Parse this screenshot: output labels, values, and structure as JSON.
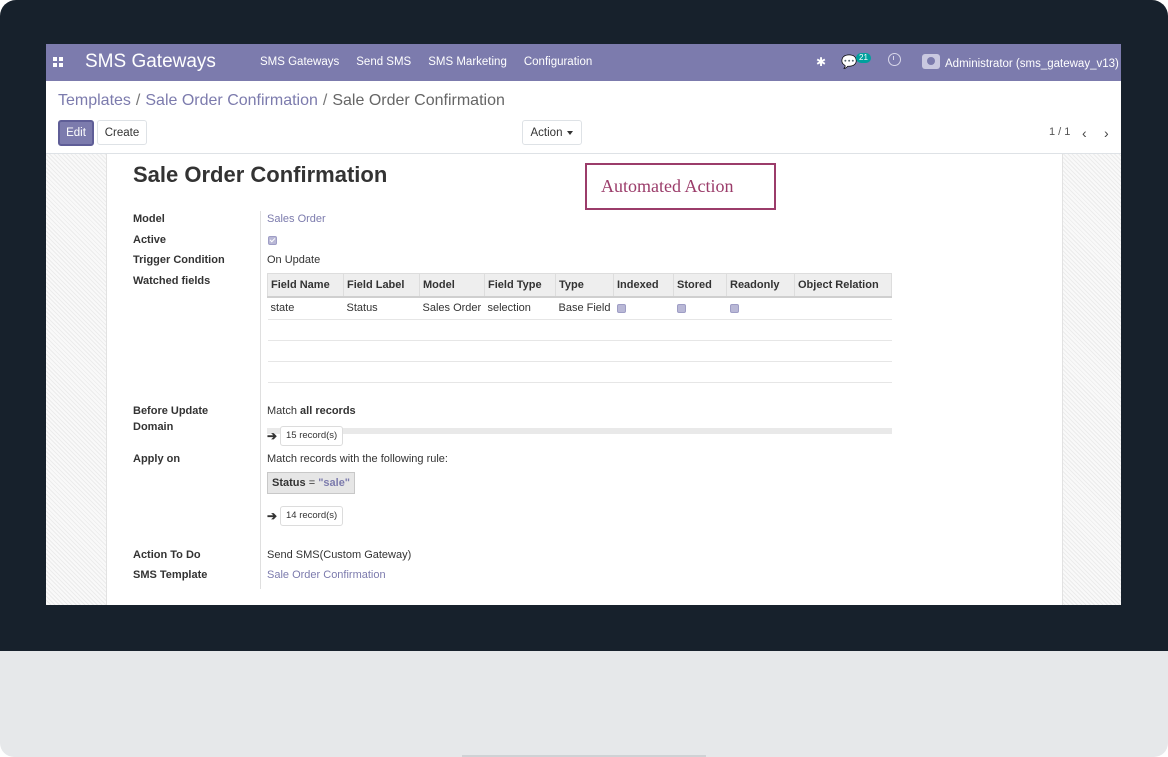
{
  "navbar": {
    "brand": "SMS Gateways",
    "menu": [
      "SMS Gateways",
      "Send SMS",
      "SMS Marketing",
      "Configuration"
    ],
    "chat_count": "21",
    "user": "Administrator (sms_gateway_v13)"
  },
  "breadcrumb": {
    "root": "Templates",
    "parent": "Sale Order Confirmation",
    "current": "Sale Order Confirmation",
    "sep": "/"
  },
  "toolbar": {
    "edit": "Edit",
    "create": "Create",
    "action": "Action",
    "pager": "1 / 1"
  },
  "record": {
    "title": "Sale Order Confirmation",
    "annotation": "Automated Action",
    "fields": {
      "model_label": "Model",
      "model_value": "Sales Order",
      "active_label": "Active",
      "active_checked": true,
      "trigger_label": "Trigger Condition",
      "trigger_value": "On Update",
      "watched_label": "Watched fields",
      "before_label": "Before Update",
      "domain_label": "Domain",
      "before_prefix": "Match",
      "before_bold": "all records",
      "before_records": "15 record(s)",
      "apply_label": "Apply on",
      "apply_text": "Match records with the following rule:",
      "rule_field": "Status",
      "rule_op": "=",
      "rule_value": "\"sale\"",
      "apply_records": "14 record(s)",
      "action_label": "Action To Do",
      "action_value": "Send SMS(Custom Gateway)",
      "template_label": "SMS Template",
      "template_value": "Sale Order Confirmation"
    },
    "watched_table": {
      "columns": [
        "Field Name",
        "Field Label",
        "Model",
        "Field Type",
        "Type",
        "Indexed",
        "Stored",
        "Readonly",
        "Object Relation"
      ],
      "rows": [
        {
          "field_name": "state",
          "field_label": "Status",
          "model": "Sales Order",
          "field_type": "selection",
          "type": "Base Field",
          "indexed": true,
          "stored": true,
          "readonly": true,
          "object_relation": ""
        }
      ]
    }
  }
}
